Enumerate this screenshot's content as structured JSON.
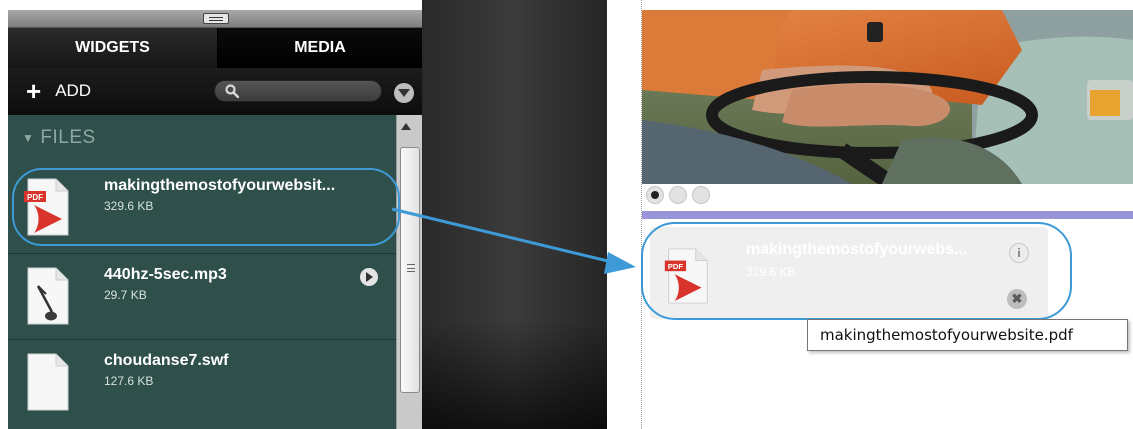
{
  "tabs": [
    {
      "label": "WIDGETS"
    },
    {
      "label": "MEDIA"
    }
  ],
  "toolbar": {
    "add_label": "ADD",
    "search_placeholder": ""
  },
  "files_section": {
    "heading": "FILES",
    "items": [
      {
        "name": "makingthemostofyourwebsit...",
        "size": "329.6 KB",
        "type": "pdf"
      },
      {
        "name": "440hz-5sec.mp3",
        "size": "29.7 KB",
        "type": "audio"
      },
      {
        "name": "choudanse7.swf",
        "size": "127.6 KB",
        "type": "swf"
      }
    ]
  },
  "preview": {
    "file_widget": {
      "name": "makingthemostofyourwebs...",
      "size": "329.6 KB",
      "info_icon": "i",
      "close_icon": "✖"
    },
    "tooltip": "makingthemostofyourwebsite.pdf",
    "slider_dots": 3,
    "active_dot": 0,
    "accent_color": "#9a94d8",
    "highlight_color": "#3d9ad6"
  }
}
